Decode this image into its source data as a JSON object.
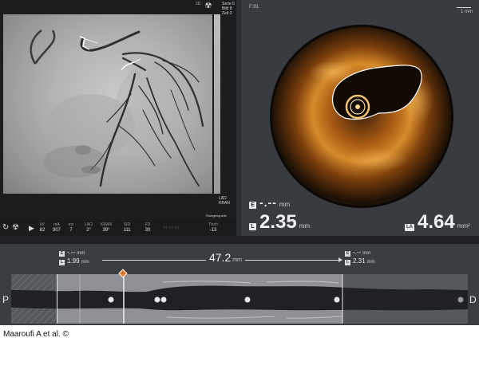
{
  "angiography": {
    "series_text": [
      "Serie 5",
      "Bild 8",
      "Zeit 3"
    ],
    "view_text": [
      "LAD",
      "KRAN"
    ],
    "strip_text": "Rontgenquelle",
    "indicator": "2D",
    "status": {
      "icons": [
        "refresh-icon",
        "radiation-icon",
        "play-icon"
      ],
      "fields": [
        {
          "label": "kV",
          "value": "82"
        },
        {
          "label": "mA",
          "value": "907"
        },
        {
          "label": "ms",
          "value": "7"
        },
        {
          "label": "LAO",
          "value": "2°"
        },
        {
          "label": "KRAN",
          "value": "39°"
        },
        {
          "label": "SID",
          "value": "111"
        },
        {
          "label": "FD",
          "value": "30"
        }
      ],
      "table_label": "Tisch",
      "table_value": "-13"
    }
  },
  "oct": {
    "frame_label": "F:91",
    "scale_label": "1 mm",
    "top_measure": {
      "badge": "E",
      "value": "-.--",
      "unit": "mm"
    },
    "lumen_diameter": {
      "badge": "L",
      "value": "2.35",
      "unit": "mm"
    },
    "lumen_area": {
      "badge": "LA",
      "value": "4.64",
      "unit": "mm²"
    }
  },
  "timeline": {
    "proximal": {
      "e_value": "-.--",
      "e_unit": "mm",
      "l_value": "1.99",
      "l_unit": "mm"
    },
    "distal": {
      "e_value": "-.--",
      "e_unit": "mm",
      "l_value": "2.31",
      "l_unit": "mm"
    },
    "length_value": "47.2",
    "length_unit": "mm",
    "left_letter": "P",
    "right_letter": "D"
  },
  "credit": "Maaroufi A et al. ©",
  "colors": {
    "marker": "#e2742a",
    "panel_bg": "#2a2d31",
    "roi": "#8f9196"
  }
}
